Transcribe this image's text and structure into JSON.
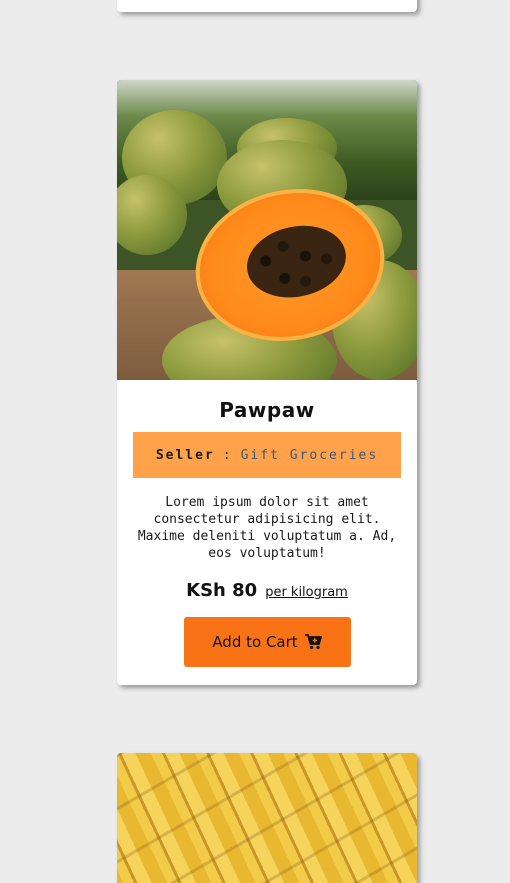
{
  "product": {
    "name": "Pawpaw",
    "seller_label": "Seller",
    "seller_separator": ":",
    "seller_name": "Gift Groceries",
    "description": "Lorem ipsum dolor sit amet consectetur adipisicing elit. Maxime deleniti voluptatum a. Ad, eos voluptatum!",
    "price": "KSh 80",
    "unit": "per kilogram",
    "add_to_cart_label": "Add to Cart"
  },
  "icons": {
    "cart": "cart-plus-icon"
  },
  "colors": {
    "background": "#ececec",
    "seller_band": "#ffa24a",
    "seller_name": "#3a5a7a",
    "button": "#f97316"
  }
}
